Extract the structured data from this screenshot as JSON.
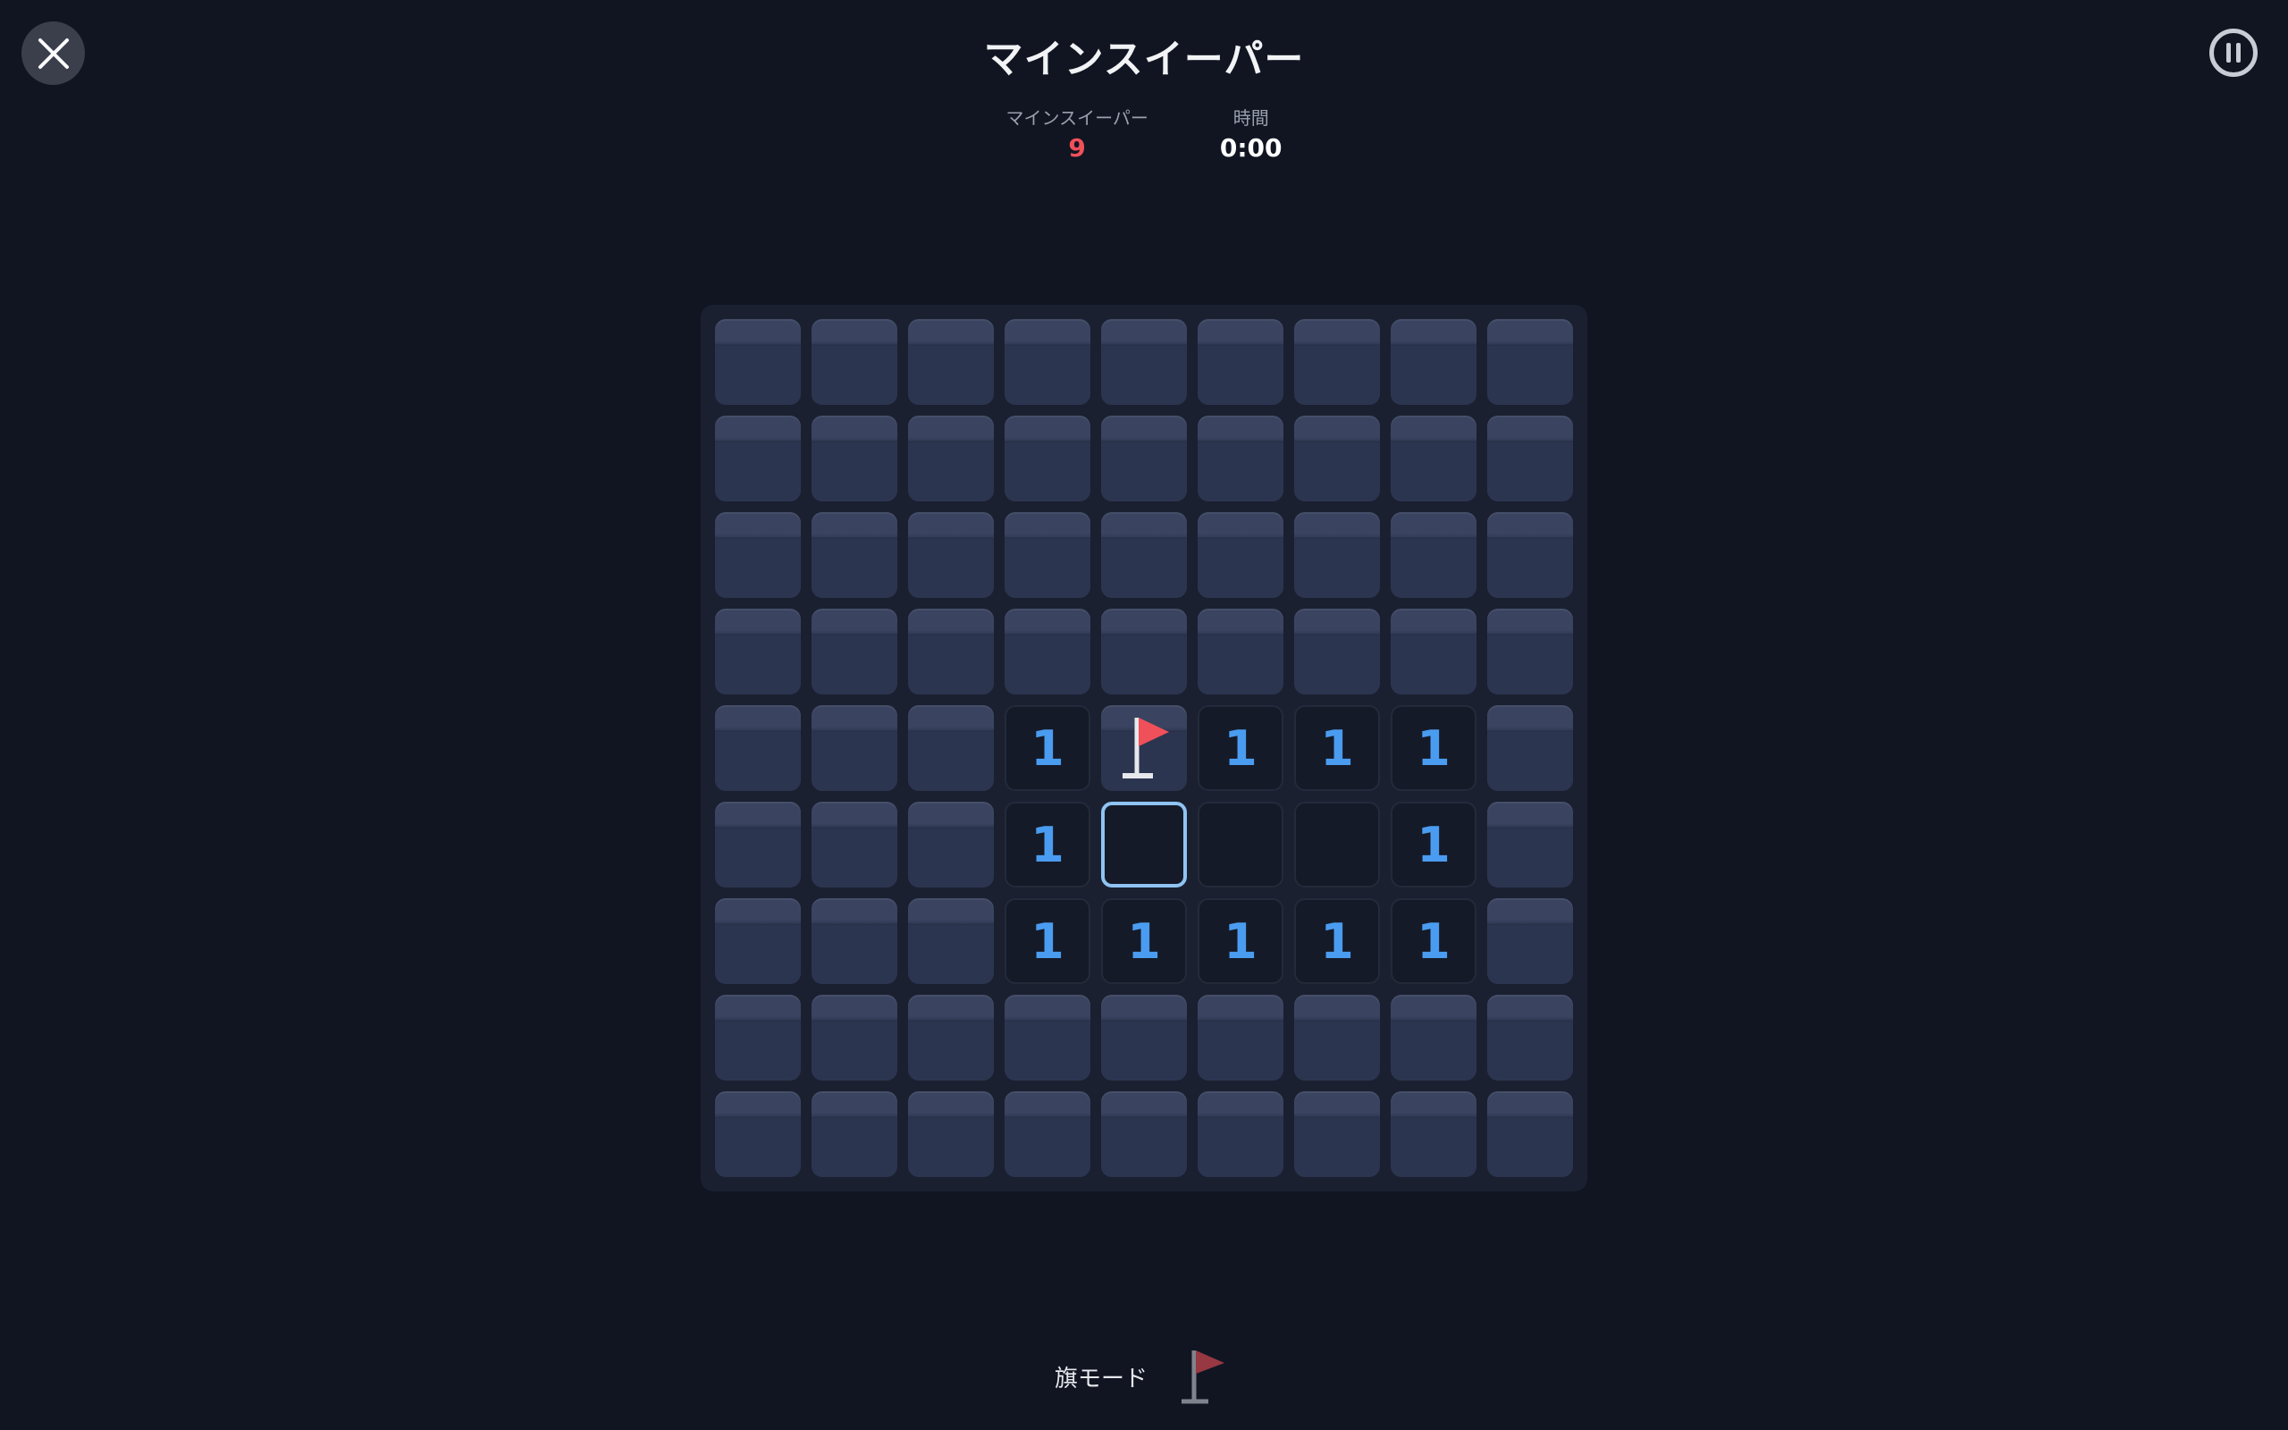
{
  "header": {
    "title": "マインスイーパー",
    "close_icon": "close-icon",
    "pause_icon": "pause-icon"
  },
  "stats": {
    "mines_label": "マインスイーパー",
    "mines_value": "9",
    "time_label": "時間",
    "time_value": "0:00"
  },
  "board": {
    "rows": 9,
    "cols": 9,
    "cells": [
      [
        "h",
        "h",
        "h",
        "h",
        "h",
        "h",
        "h",
        "h",
        "h"
      ],
      [
        "h",
        "h",
        "h",
        "h",
        "h",
        "h",
        "h",
        "h",
        "h"
      ],
      [
        "h",
        "h",
        "h",
        "h",
        "h",
        "h",
        "h",
        "h",
        "h"
      ],
      [
        "h",
        "h",
        "h",
        "h",
        "h",
        "h",
        "h",
        "h",
        "h"
      ],
      [
        "h",
        "h",
        "h",
        "1",
        "f",
        "1",
        "1",
        "1",
        "h"
      ],
      [
        "h",
        "h",
        "h",
        "1",
        "s",
        "e",
        "e",
        "1",
        "h"
      ],
      [
        "h",
        "h",
        "h",
        "1",
        "1",
        "1",
        "1",
        "1",
        "h"
      ],
      [
        "h",
        "h",
        "h",
        "h",
        "h",
        "h",
        "h",
        "h",
        "h"
      ],
      [
        "h",
        "h",
        "h",
        "h",
        "h",
        "h",
        "h",
        "h",
        "h"
      ]
    ]
  },
  "footer": {
    "flag_mode_label": "旗モード",
    "flag_icon": "flag-icon"
  },
  "colors": {
    "background": "#111522",
    "number": "#4a9cf0",
    "flag": "#f0505a",
    "mine_count": "#f0505a",
    "selected_border": "#8fc3f2"
  }
}
